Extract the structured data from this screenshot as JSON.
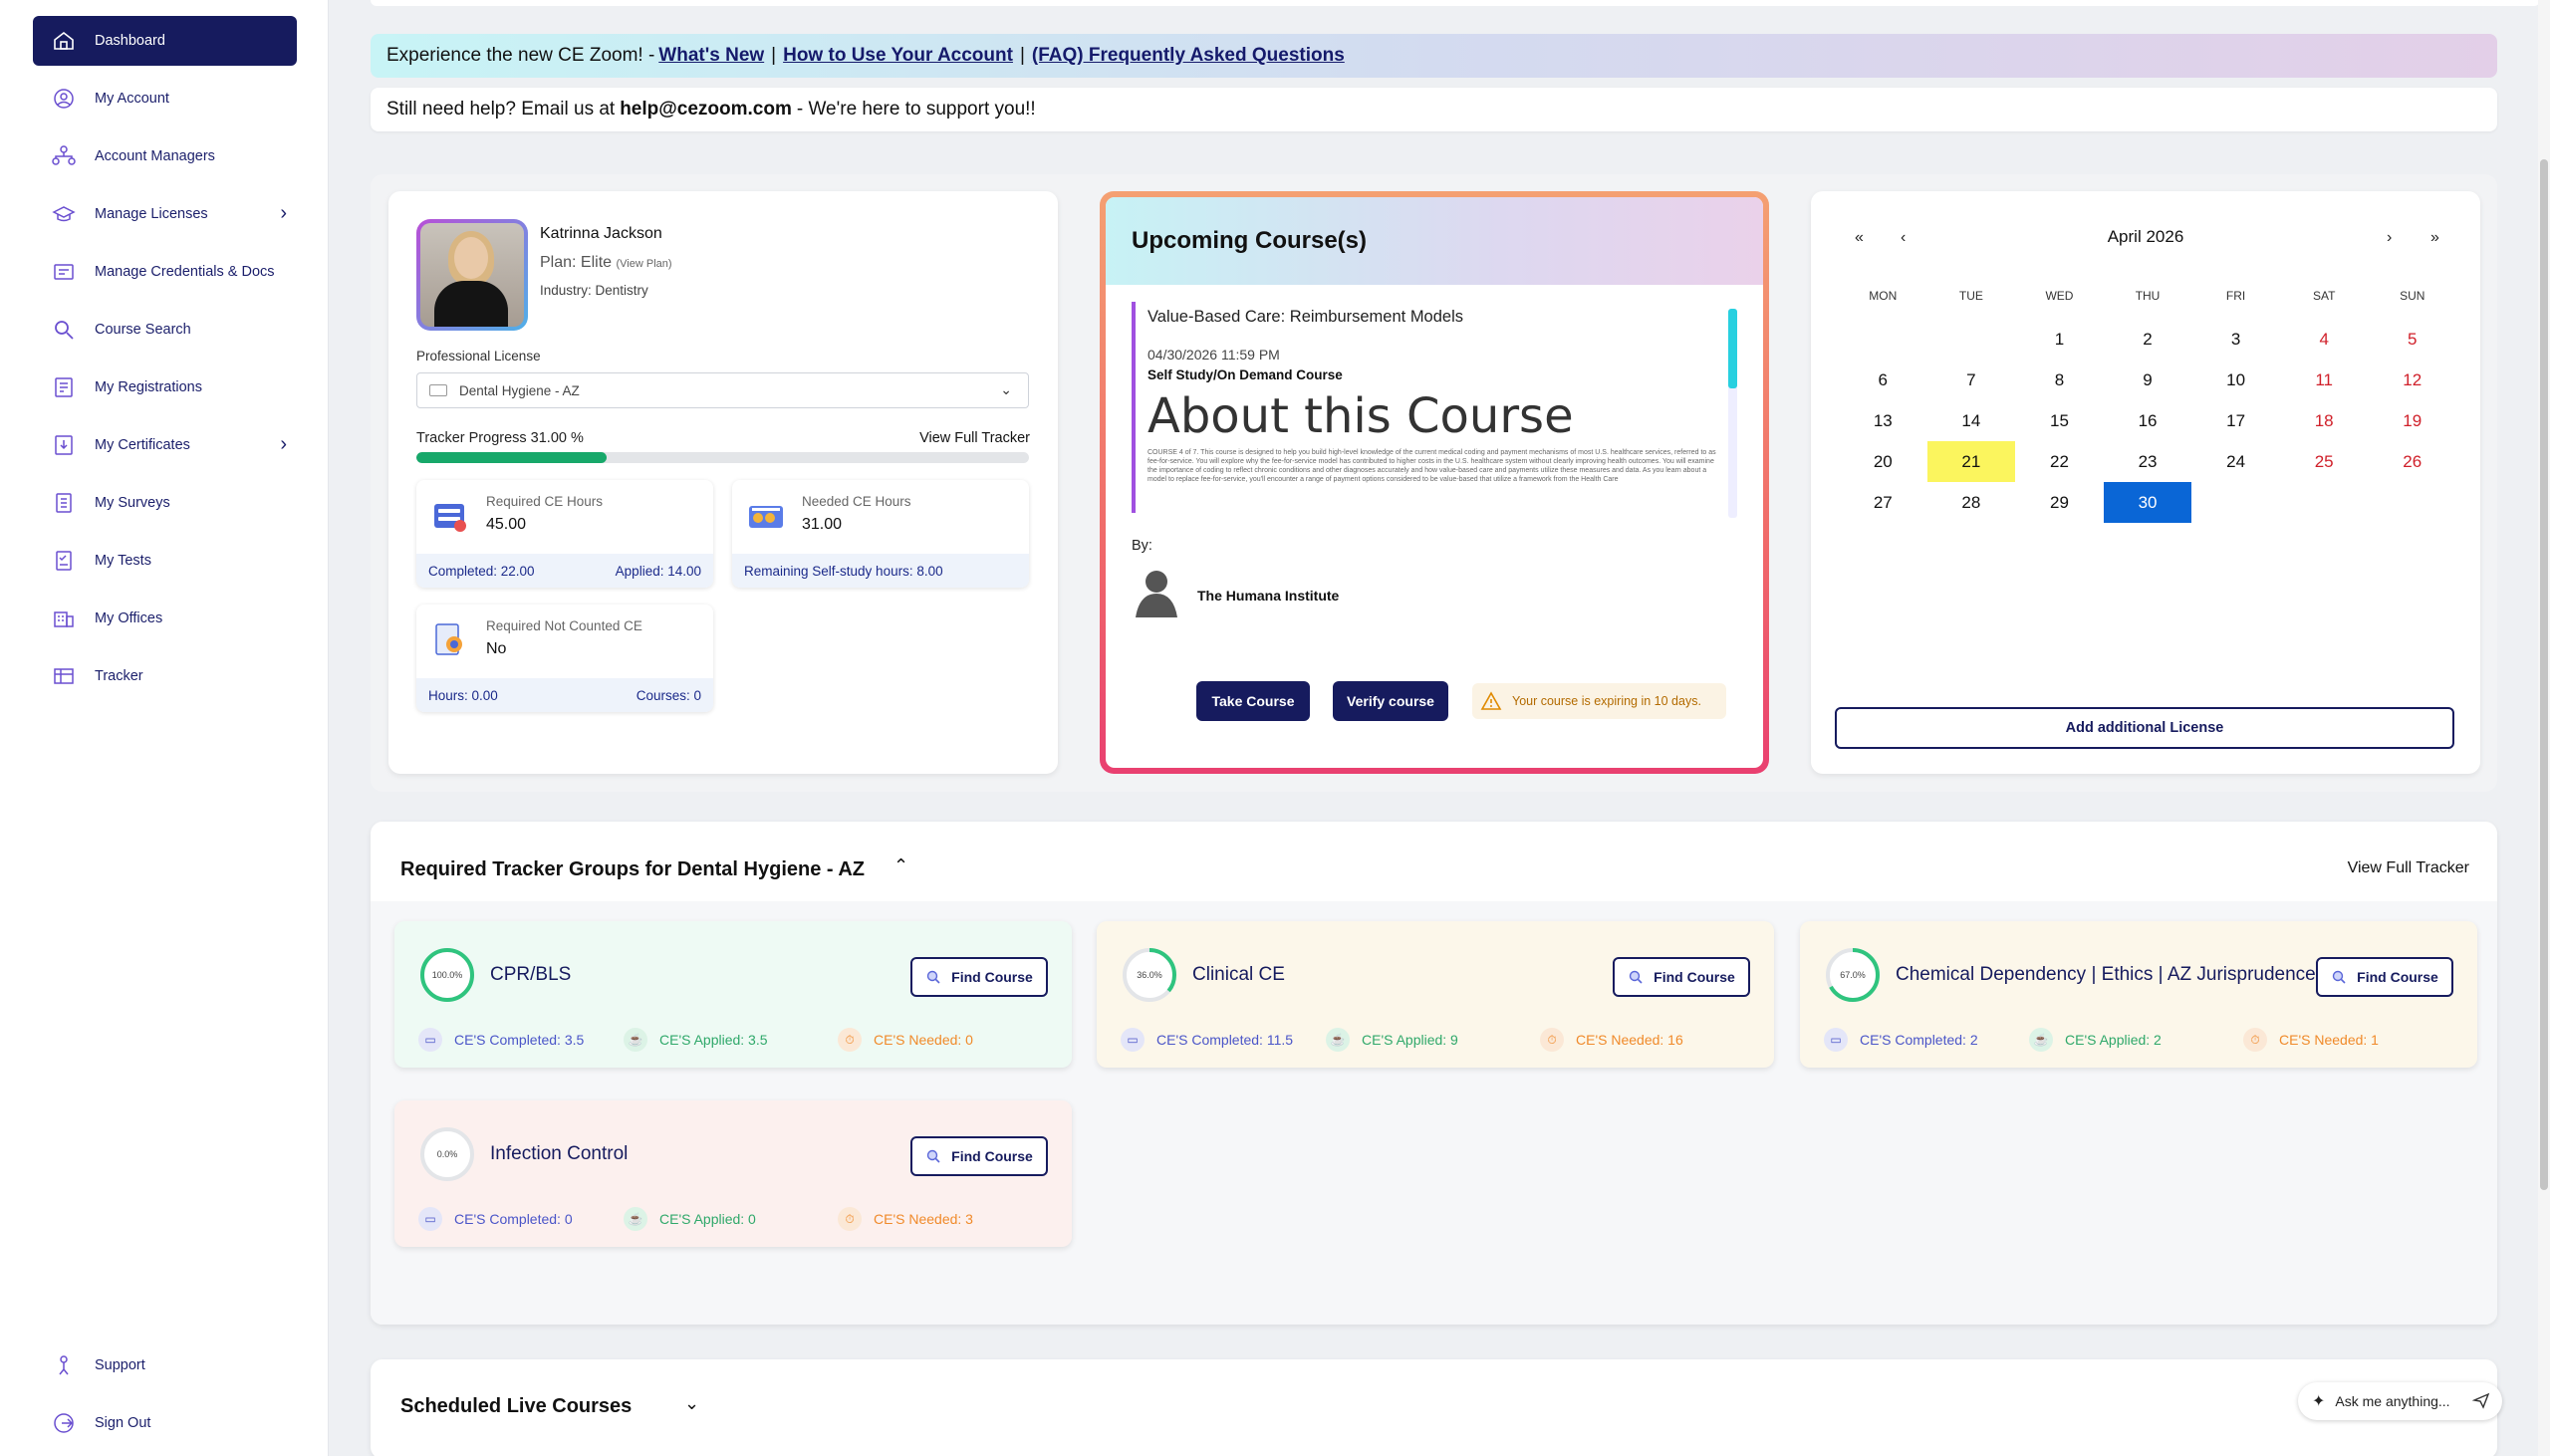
{
  "sidebar": {
    "items": [
      {
        "label": "Dashboard",
        "icon": "home-icon"
      },
      {
        "label": "My Account",
        "icon": "account-icon"
      },
      {
        "label": "Account Managers",
        "icon": "managers-icon"
      },
      {
        "label": "Manage Licenses",
        "icon": "license-icon"
      },
      {
        "label": "Manage Credentials & Docs",
        "icon": "credentials-icon"
      },
      {
        "label": "Course Search",
        "icon": "search-icon"
      },
      {
        "label": "My Registrations",
        "icon": "registrations-icon"
      },
      {
        "label": "My Certificates",
        "icon": "certificate-icon"
      },
      {
        "label": "My Surveys",
        "icon": "survey-icon"
      },
      {
        "label": "My Tests",
        "icon": "test-icon"
      },
      {
        "label": "My Offices",
        "icon": "office-icon"
      },
      {
        "label": "Tracker",
        "icon": "tracker-icon"
      }
    ],
    "bottom": [
      {
        "label": "Support",
        "icon": "support-icon"
      },
      {
        "label": "Sign Out",
        "icon": "signout-icon"
      }
    ]
  },
  "banner": {
    "intro": "Experience the new CE Zoom! -",
    "link1": "What's New",
    "link2": "How to Use Your Account",
    "link3": "(FAQ) Frequently Asked Questions",
    "sep": "|"
  },
  "help": {
    "prefix": "Still need help? Email us at",
    "email": "help@cezoom.com",
    "suffix": "- We're here to support you!!"
  },
  "profile": {
    "name": "Katrinna Jackson",
    "plan": "Plan: Elite",
    "view_plan": "(View Plan)",
    "industry": "Industry: Dentistry",
    "license_label": "Professional License",
    "license_value": "Dental Hygiene - AZ",
    "progress_label": "Tracker Progress 31.00 %",
    "progress_value": 0.31,
    "view_tracker": "View Full Tracker",
    "stats": {
      "required": {
        "title": "Required CE Hours",
        "value": "45.00",
        "foot_left": "Completed: 22.00",
        "foot_right": "Applied: 14.00"
      },
      "needed": {
        "title": "Needed CE Hours",
        "value": "31.00",
        "foot_left": "Remaining Self-study hours: 8.00",
        "foot_right": ""
      },
      "not_counted": {
        "title": "Required Not Counted CE",
        "value": "No",
        "foot_left": "Hours: 0.00",
        "foot_right": "Courses: 0"
      }
    }
  },
  "upcoming": {
    "title": "Upcoming Course(s)",
    "course_title": "Value-Based Care: Reimbursement Models",
    "date": "04/30/2026 11:59 PM",
    "type": "Self Study/On Demand Course",
    "about": "About this Course",
    "description": "COURSE 4 of 7. This course is designed to help you build high-level knowledge of the current medical coding and payment mechanisms of most U.S. healthcare services, referred to as fee-for-service. You will explore why the fee-for-service model has contributed to higher costs in the U.S. healthcare system without clearly improving health outcomes. You will examine the importance of coding to reflect chronic conditions and other diagnoses accurately and how value-based care and payments utilize these measures and data. As you learn about a model to replace fee-for-service, you'll encounter a range of payment options considered to be value-based that utilize a framework from the Health Care",
    "by": "By:",
    "institute": "The Humana Institute",
    "take_btn": "Take Course",
    "verify_btn": "Verify course",
    "warning": "Your course is expiring in 10 days."
  },
  "calendar": {
    "title": "April 2026",
    "nav": {
      "first": "«",
      "prev": "‹",
      "next": "›",
      "last": "»"
    },
    "weekdays": [
      "MON",
      "TUE",
      "WED",
      "THU",
      "FRI",
      "SAT",
      "SUN"
    ],
    "weeks": [
      [
        "",
        "",
        "1",
        "2",
        "3",
        "4",
        "5"
      ],
      [
        "6",
        "7",
        "8",
        "9",
        "10",
        "11",
        "12"
      ],
      [
        "13",
        "14",
        "15",
        "16",
        "17",
        "18",
        "19"
      ],
      [
        "20",
        "21",
        "22",
        "23",
        "24",
        "25",
        "26"
      ],
      [
        "27",
        "28",
        "29",
        "30",
        "",
        "",
        ""
      ]
    ],
    "today": "21",
    "selected": "30",
    "add_btn": "Add additional License"
  },
  "tracker": {
    "title": "Required Tracker Groups for Dental Hygiene - AZ",
    "view_link": "View Full Tracker",
    "groups": [
      {
        "name": "CPR/BLS",
        "percent_label": "100.0%",
        "percent": 1.0,
        "completed": "CE'S Completed: 3.5",
        "applied": "CE'S Applied: 3.5",
        "needed": "CE'S Needed: 0",
        "btn": "Find Course",
        "bg": "#eefaf4"
      },
      {
        "name": "Clinical CE",
        "percent_label": "36.0%",
        "percent": 0.36,
        "completed": "CE'S Completed: 11.5",
        "applied": "CE'S Applied: 9",
        "needed": "CE'S Needed: 16",
        "btn": "Find Course",
        "bg": "#fcf7ea"
      },
      {
        "name": "Chemical Dependency | Ethics | AZ Jurisprudence",
        "percent_label": "67.0%",
        "percent": 0.67,
        "completed": "CE'S Completed: 2",
        "applied": "CE'S Applied: 2",
        "needed": "CE'S Needed: 1",
        "btn": "Find Course",
        "bg": "#fcf7ea"
      },
      {
        "name": "Infection Control",
        "percent_label": "0.0%",
        "percent": 0.0,
        "completed": "CE'S Completed: 0",
        "applied": "CE'S Applied: 0",
        "needed": "CE'S Needed: 3",
        "btn": "Find Course",
        "bg": "#fcf0ee"
      }
    ]
  },
  "scheduled": {
    "title": "Scheduled Live Courses"
  },
  "ask": {
    "placeholder": "Ask me anything..."
  },
  "colors": {
    "navy": "#161b5e",
    "green": "#17a86a",
    "highlight": "#fbf55e",
    "selected": "#0a66d6"
  }
}
